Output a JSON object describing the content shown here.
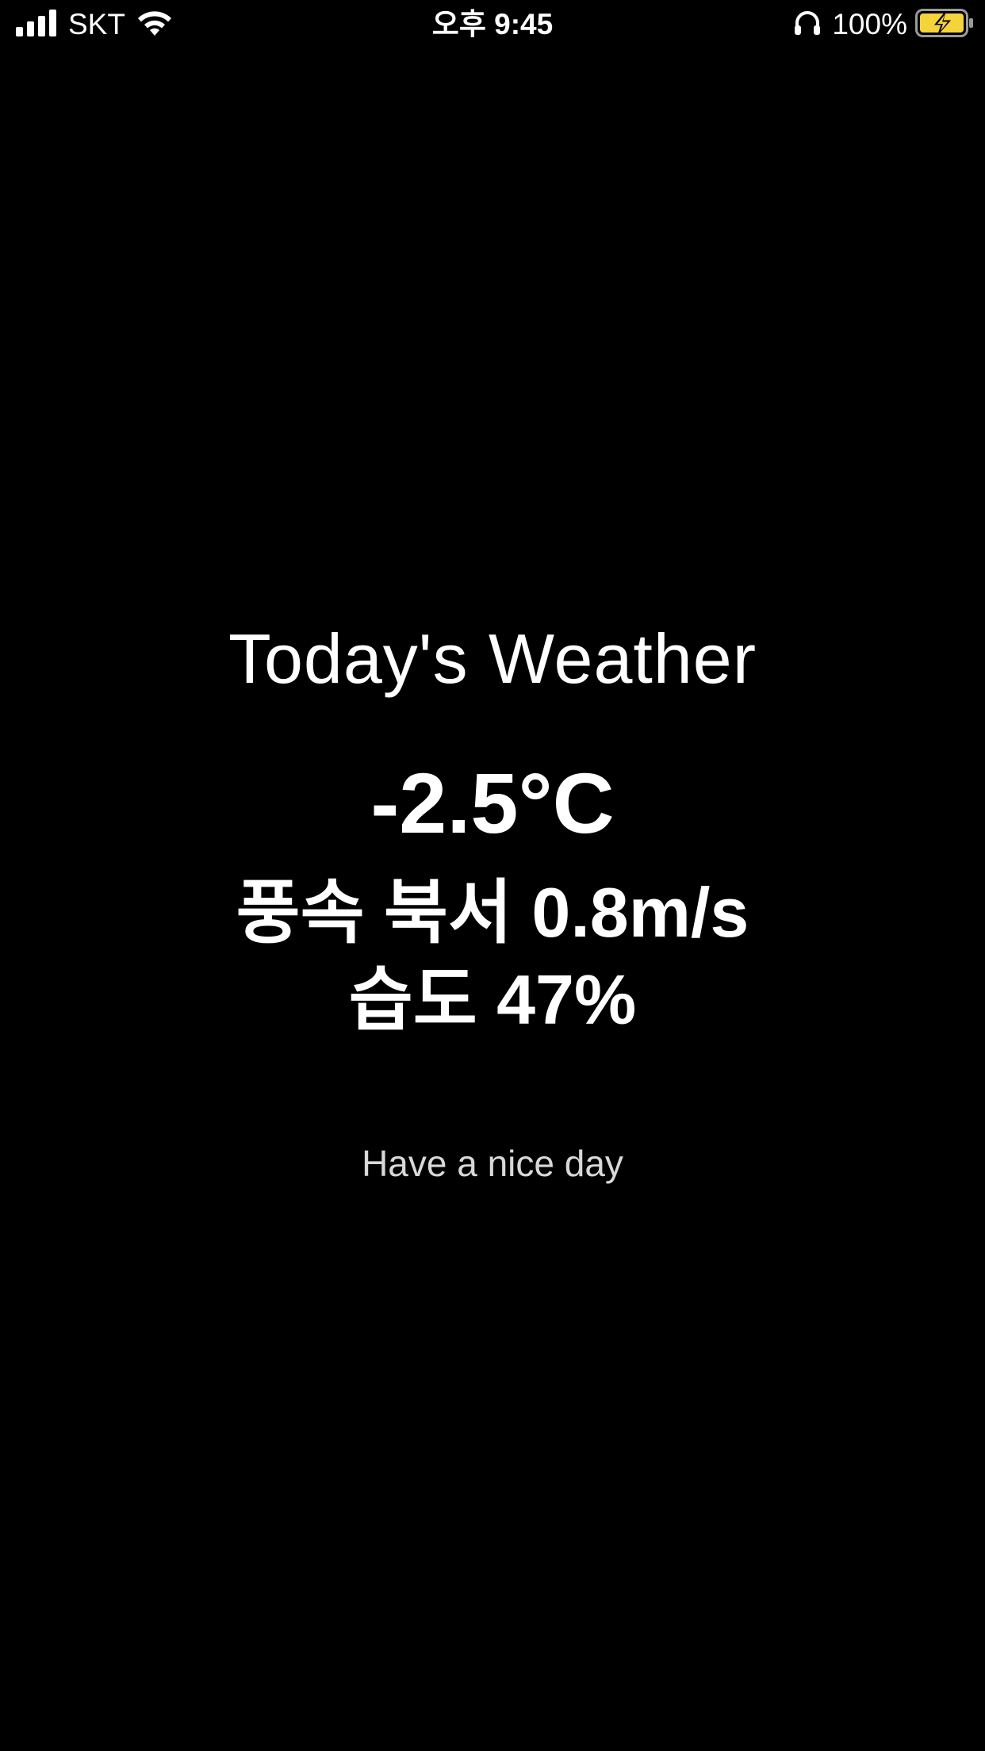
{
  "status_bar": {
    "carrier": "SKT",
    "time": "오후 9:45",
    "battery_percent": "100%",
    "signal_icon": "cellular-signal-icon",
    "wifi_icon": "wifi-icon",
    "headphones_icon": "headphones-icon",
    "battery_icon": "battery-charging-icon",
    "battery_color": "#f5d33b"
  },
  "weather": {
    "title": "Today's Weather",
    "temperature": "-2.5°C",
    "wind": "풍속 북서 0.8m/s",
    "humidity": "습도 47%",
    "greeting": "Have a nice day"
  }
}
